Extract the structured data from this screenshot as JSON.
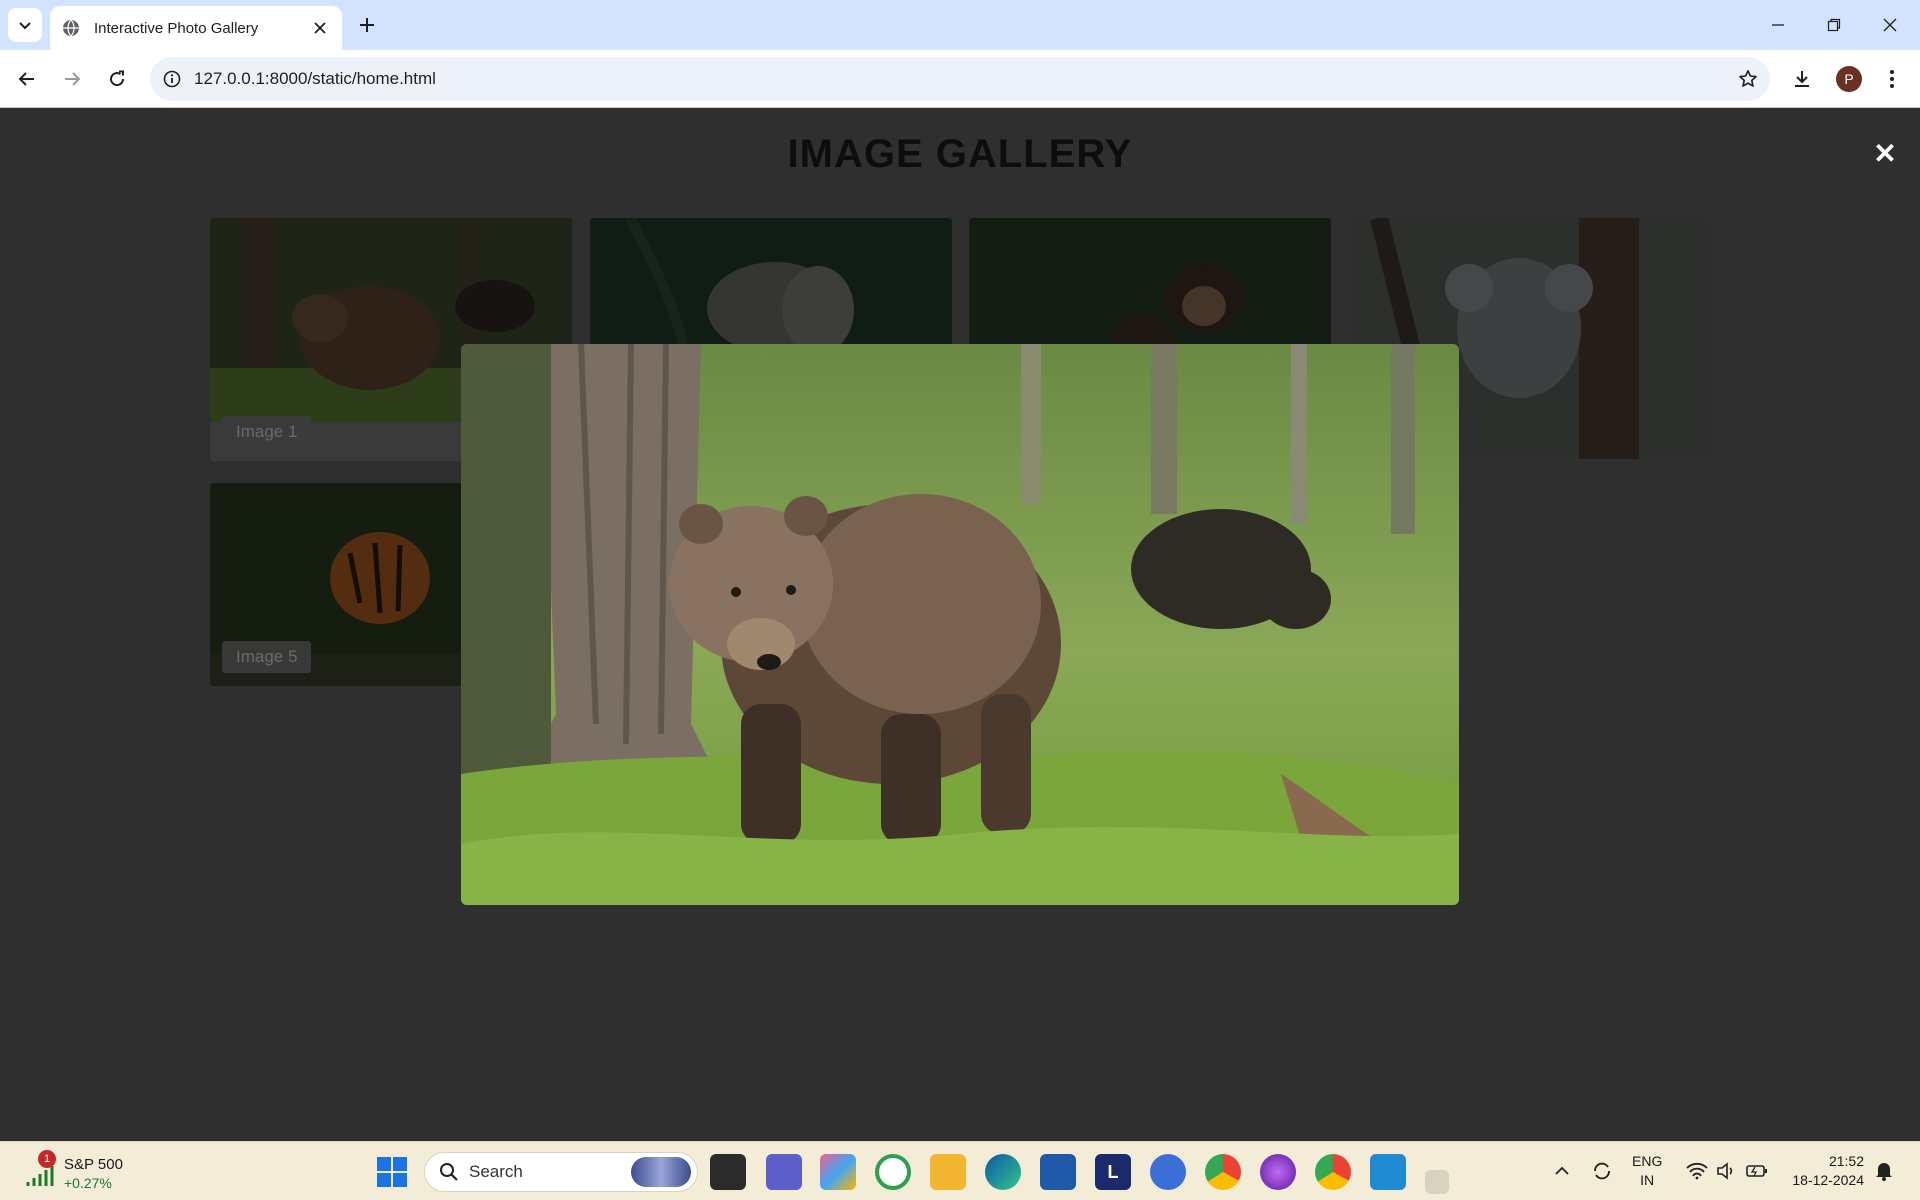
{
  "browser": {
    "tab_title": "Interactive Photo Gallery",
    "url": "127.0.0.1:8000/static/home.html",
    "profile_initial": "P"
  },
  "page": {
    "title": "IMAGE GALLERY",
    "close_symbol": "✕",
    "cards": [
      {
        "caption": "Image 1",
        "subject": "brown bears in forest"
      },
      {
        "caption": "",
        "subject": "elephant"
      },
      {
        "caption": "",
        "subject": "chimpanzee"
      },
      {
        "caption": "",
        "subject": "koala"
      },
      {
        "caption": "Image 5",
        "subject": "tiger"
      }
    ],
    "lightbox": {
      "subject": "brown bear in forest (enlarged)"
    }
  },
  "taskbar": {
    "widget_name": "S&P 500",
    "widget_change": "+0.27%",
    "widget_badge": "1",
    "search_label": "Search",
    "lang_line1": "ENG",
    "lang_line2": "IN",
    "time": "21:52",
    "date": "18-12-2024"
  }
}
